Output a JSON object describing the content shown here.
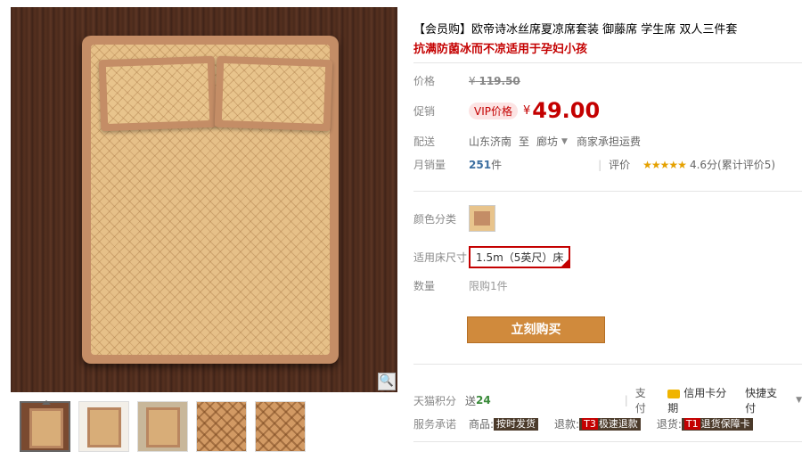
{
  "title": "【会员购】欧帝诗冰丝席夏凉席套装 御藤席 学生席 双人三件套",
  "subtitle": "抗满防菌冰而不凉适用于孕妇小孩",
  "zoom_icon": "magnifier-icon",
  "price": {
    "orig_label": "价格",
    "orig_currency": "¥",
    "orig_value": "119.50",
    "sale_label": "促销",
    "vip_badge": "VIP价格",
    "sale_currency": "¥",
    "sale_value": "49.00"
  },
  "delivery": {
    "label": "配送",
    "from": "山东济南",
    "to_label": "至",
    "to": "廊坊",
    "fee": "商家承担运费"
  },
  "sales": {
    "label": "月销量",
    "count": "251",
    "unit": "件",
    "rating_label": "评价",
    "stars": "★★★★★",
    "rating": "4.6分(累计评价5)"
  },
  "options": {
    "color_label": "颜色分类",
    "size_label": "适用床尺寸",
    "size_value": "1.5m（5英尺）床",
    "qty_label": "数量",
    "qty_value": "限购1件"
  },
  "buy_button": "立刻购买",
  "points": {
    "label": "天猫积分",
    "send": "送",
    "amount": "24"
  },
  "payment": {
    "label": "支付",
    "card": "信用卡分期",
    "quick": "快捷支付"
  },
  "service": {
    "label": "服务承诺",
    "goods_label": "商品:",
    "goods_tag": "按时发货",
    "refund_label": "退款:",
    "refund_badge": "T3",
    "refund_tag": "极速退款",
    "return_label": "退货:",
    "return_badge": "T1",
    "return_tag": "退货保障卡"
  },
  "colors": {
    "accent_red": "#c40000",
    "buy_orange": "#d08a3c"
  }
}
